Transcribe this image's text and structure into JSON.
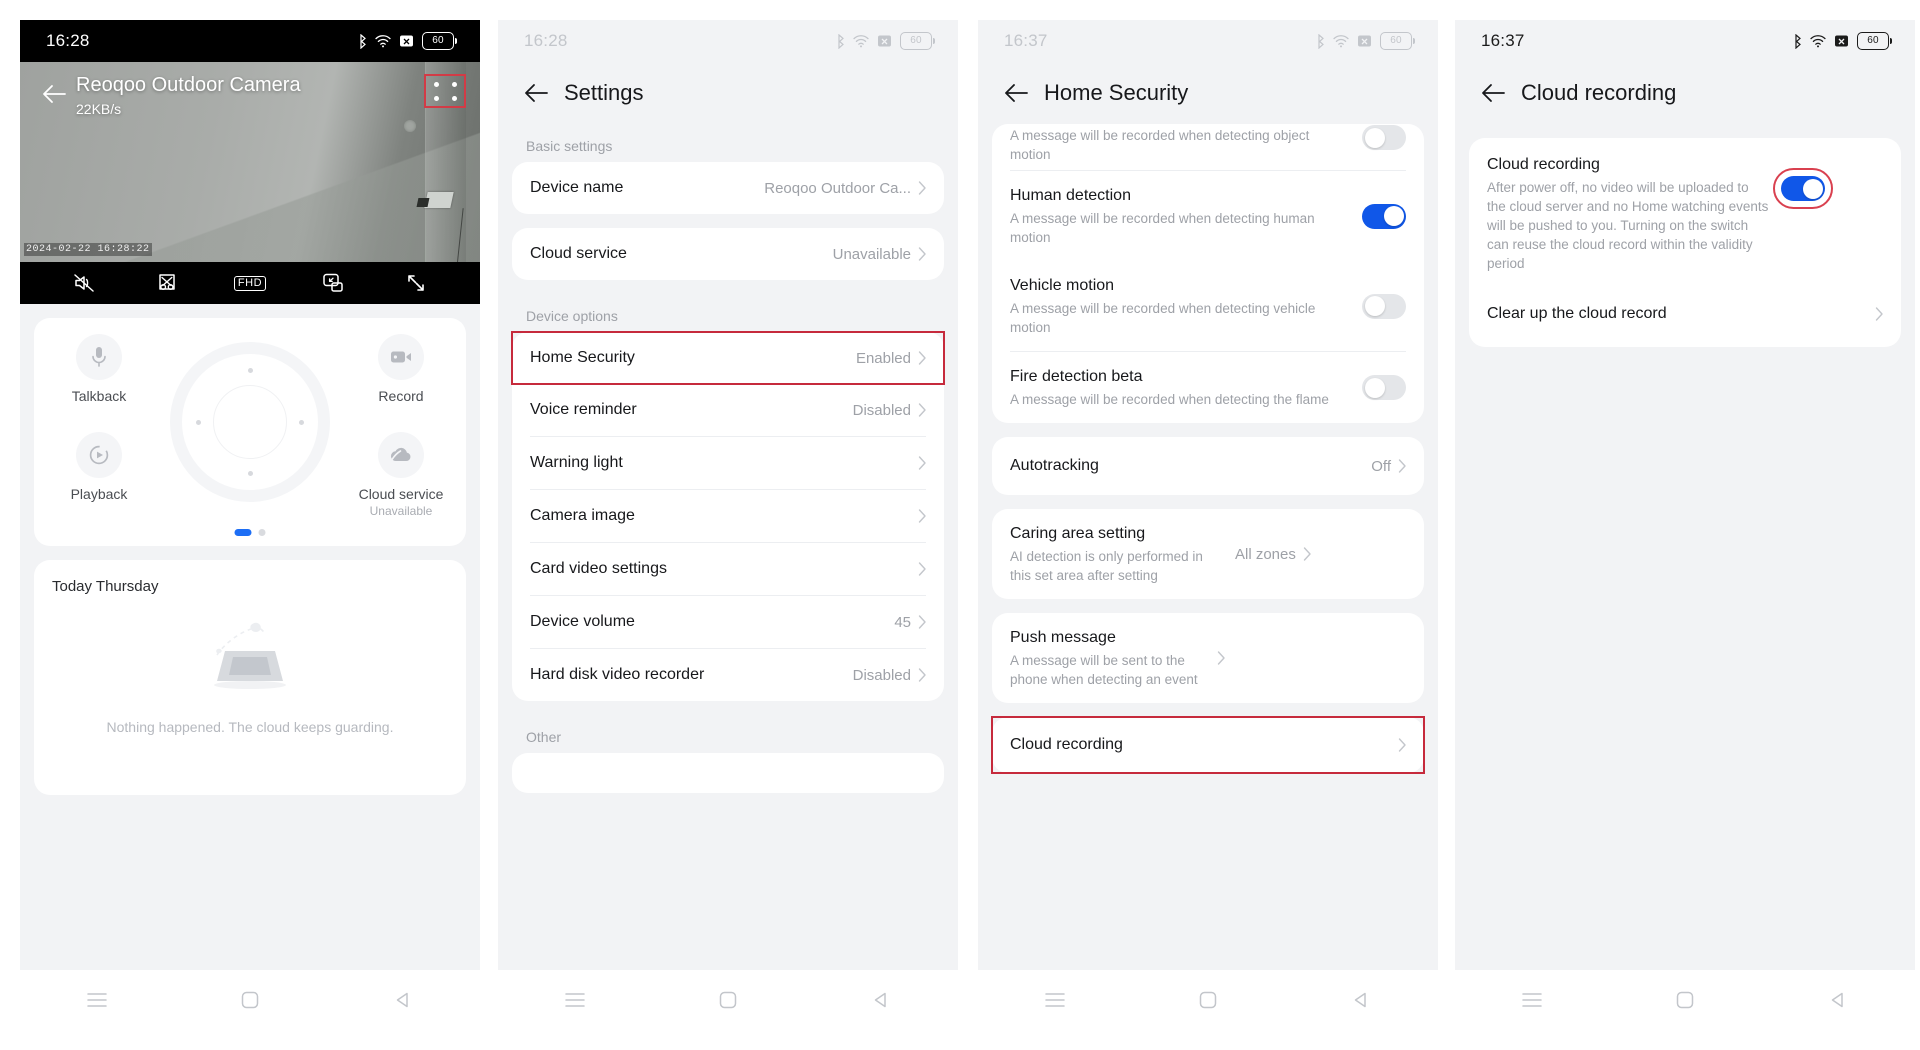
{
  "panels": {
    "live": {
      "status": {
        "time": "16:28",
        "battery": "60"
      },
      "back_icon": "arrow-left-icon",
      "device_title": "Reoqoo Outdoor Camera",
      "bitrate": "22KB/s",
      "menu_icon": "grid-menu-icon",
      "timestamp": "2024-02-22  16:28:22",
      "controls": [
        {
          "name": "mute-icon",
          "label": "Mute"
        },
        {
          "name": "snapshot-scissors-icon",
          "label": "Clip"
        },
        {
          "name": "fhd-quality-icon",
          "label": "FHD"
        },
        {
          "name": "picture-in-picture-icon",
          "label": "PiP"
        },
        {
          "name": "fullscreen-icon",
          "label": "Fullscreen"
        }
      ],
      "quick_actions": [
        {
          "icon": "microphone-icon",
          "label": "Talkback",
          "sub": ""
        },
        {
          "icon": "video-camera-icon",
          "label": "Record",
          "sub": ""
        },
        {
          "icon": "playback-icon",
          "label": "Playback",
          "sub": ""
        },
        {
          "icon": "cloud-icon",
          "label": "Cloud service",
          "sub": "Unavailable"
        }
      ],
      "pager": {
        "pages": 2,
        "active": 1
      },
      "today": {
        "title": "Today Thursday",
        "empty_text": "Nothing happened. The cloud keeps guarding."
      }
    },
    "settings": {
      "status": {
        "time": "16:28",
        "battery": "60"
      },
      "back_icon": "arrow-left-icon",
      "title": "Settings",
      "groups": [
        {
          "label": "Basic settings",
          "cards": [
            {
              "rows": [
                {
                  "title": "Device name",
                  "value": "Reoqoo Outdoor Ca...",
                  "chevron": true
                }
              ]
            },
            {
              "rows": [
                {
                  "title": "Cloud service",
                  "value": "Unavailable",
                  "chevron": true
                }
              ]
            }
          ]
        },
        {
          "label": "Device options",
          "cards": [
            {
              "rows": [
                {
                  "title": "Home Security",
                  "value": "Enabled",
                  "chevron": true,
                  "highlight": true
                },
                {
                  "title": "Voice reminder",
                  "value": "Disabled",
                  "chevron": true
                },
                {
                  "title": "Warning light",
                  "value": "",
                  "chevron": true
                },
                {
                  "title": "Camera image",
                  "value": "",
                  "chevron": true
                },
                {
                  "title": "Card video settings",
                  "value": "",
                  "chevron": true
                },
                {
                  "title": "Device volume",
                  "value": "45",
                  "chevron": true
                },
                {
                  "title": "Hard disk video recorder",
                  "value": "Disabled",
                  "chevron": true
                }
              ]
            }
          ]
        },
        {
          "label": "Other",
          "cards": [
            {
              "rows": []
            }
          ]
        }
      ]
    },
    "home_security": {
      "status": {
        "time": "16:37",
        "battery": "60"
      },
      "back_icon": "arrow-left-icon",
      "title": "Home Security",
      "cards": [
        {
          "rows": [
            {
              "title": "",
              "desc": "A message will be recorded when detecting object motion",
              "toggle": "off",
              "clipped": true
            },
            {
              "title": "Human detection",
              "desc": "A message will be recorded when detecting human motion",
              "toggle": "on"
            },
            {
              "title": "Vehicle motion",
              "desc": "A message will be recorded when detecting vehicle motion",
              "toggle": "off"
            },
            {
              "title": "Fire detection beta",
              "desc": "A message will be recorded when detecting the flame",
              "toggle": "off"
            }
          ]
        },
        {
          "rows": [
            {
              "title": "Autotracking",
              "value": "Off",
              "chevron": true
            }
          ]
        },
        {
          "rows": [
            {
              "title": "Caring area setting",
              "desc": "AI detection is only performed in this set area after setting",
              "value": "All zones",
              "chevron": true
            }
          ]
        },
        {
          "rows": [
            {
              "title": "Push message",
              "desc": "A message will be sent to the phone when detecting an event",
              "chevron": true
            }
          ]
        },
        {
          "rows": [
            {
              "title": "Cloud recording",
              "value": "",
              "chevron": true,
              "highlight": true
            }
          ]
        }
      ]
    },
    "cloud_recording": {
      "status": {
        "time": "16:37",
        "battery": "60"
      },
      "back_icon": "arrow-left-icon",
      "title": "Cloud recording",
      "rows": [
        {
          "title": "Cloud recording",
          "desc": "After power off, no video will be uploaded to the cloud server and no Home watching events will be pushed to you. Turning on the switch can reuse the cloud record within the validity period",
          "toggle": "on",
          "toggle_highlight": true
        },
        {
          "title": "Clear up the cloud record",
          "chevron": true
        }
      ]
    }
  },
  "navbar": [
    {
      "icon": "recents-menu-icon"
    },
    {
      "icon": "home-square-icon"
    },
    {
      "icon": "back-triangle-icon"
    }
  ],
  "colors": {
    "accent": "#1057e8",
    "highlight": "#c62a3c",
    "page_bg": "#f2f3f5",
    "card_bg": "#ffffff",
    "muted_text": "#9ea1a7"
  }
}
